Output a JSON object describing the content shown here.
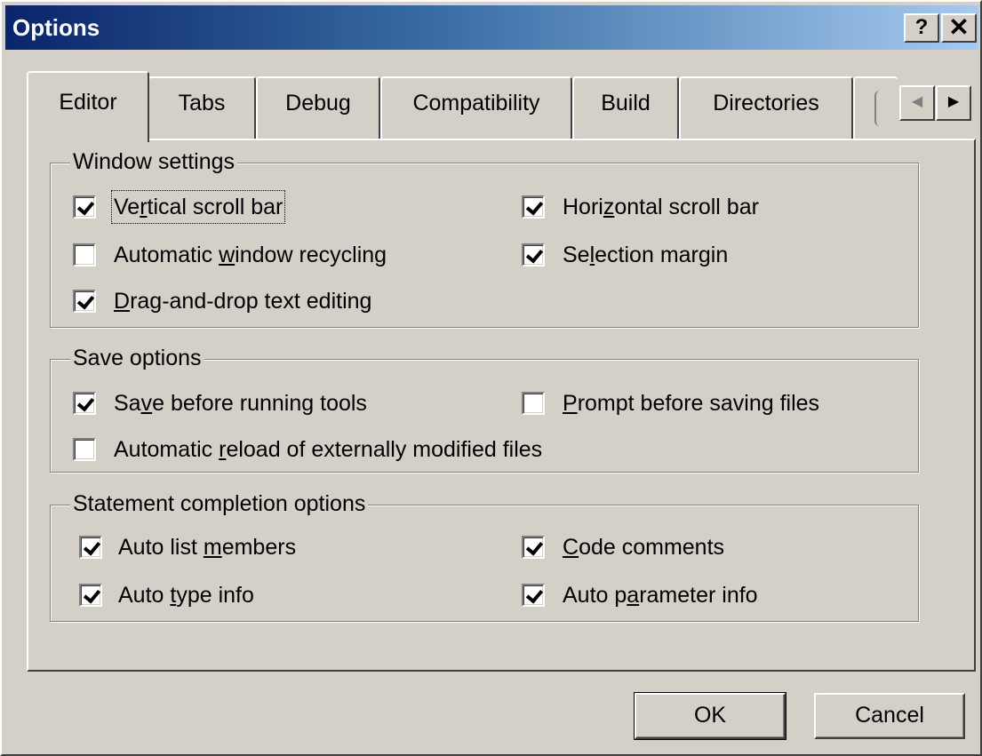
{
  "window": {
    "title": "Options",
    "help_label": "?",
    "close_label": "✕"
  },
  "tabs": [
    {
      "label": "Editor",
      "active": true
    },
    {
      "label": "Tabs"
    },
    {
      "label": "Debug"
    },
    {
      "label": "Compatibility"
    },
    {
      "label": "Build"
    },
    {
      "label": "Directories"
    }
  ],
  "tab_scroll": {
    "left_icon": "◀",
    "right_icon": "▶"
  },
  "groups": {
    "window_settings": {
      "legend": "Window settings",
      "items": {
        "vertical_scroll": {
          "label_pre": "Ve",
          "label_key": "r",
          "label_post": "tical scroll bar",
          "checked": true
        },
        "horizontal_scroll": {
          "label_pre": "Hori",
          "label_key": "z",
          "label_post": "ontal scroll bar",
          "checked": true
        },
        "auto_recycle": {
          "label_pre": "Automatic ",
          "label_key": "w",
          "label_post": "indow recycling",
          "checked": false
        },
        "selection_margin": {
          "label_pre": "Se",
          "label_key": "l",
          "label_post": "ection margin",
          "checked": true
        },
        "drag_drop": {
          "label_pre": "",
          "label_key": "D",
          "label_post": "rag-and-drop text editing",
          "checked": true
        }
      }
    },
    "save_options": {
      "legend": "Save options",
      "items": {
        "save_before_tools": {
          "label_pre": "Sa",
          "label_key": "v",
          "label_post": "e before running tools",
          "checked": true
        },
        "prompt_before_save": {
          "label_pre": "",
          "label_key": "P",
          "label_post": "rompt before saving files",
          "checked": false
        },
        "auto_reload": {
          "label_pre": "Automatic ",
          "label_key": "r",
          "label_post": "eload of externally modified files",
          "checked": false
        }
      }
    },
    "statement_completion": {
      "legend": "Statement completion options",
      "items": {
        "auto_list_members": {
          "label_pre": "Auto list ",
          "label_key": "m",
          "label_post": "embers",
          "checked": true
        },
        "code_comments": {
          "label_pre": "",
          "label_key": "C",
          "label_post": "ode comments",
          "checked": true
        },
        "auto_type_info": {
          "label_pre": "Auto ",
          "label_key": "t",
          "label_post": "ype info",
          "checked": true
        },
        "auto_param_info": {
          "label_pre": "Auto p",
          "label_key": "a",
          "label_post": "rameter info",
          "checked": true
        }
      }
    }
  },
  "buttons": {
    "ok": "OK",
    "cancel": "Cancel"
  }
}
